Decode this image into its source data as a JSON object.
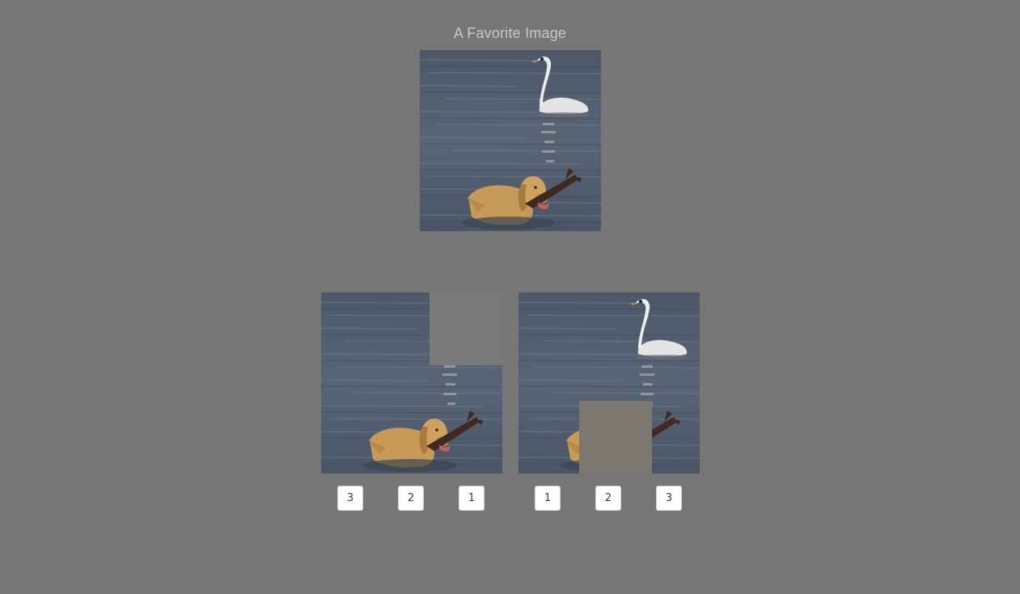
{
  "title": "A Favorite Image",
  "images": {
    "main": {
      "icon": "dog-and-swan-photo"
    },
    "left": {
      "icon": "dog-and-swan-photo-masked-top-right"
    },
    "right": {
      "icon": "dog-and-swan-photo-masked-bottom-center"
    }
  },
  "left_buttons": [
    "3",
    "2",
    "1"
  ],
  "right_buttons": [
    "1",
    "2",
    "3"
  ],
  "colors": {
    "background": "#767676",
    "title": "#c9c9c9",
    "water": "#53606f",
    "dog": "#c49a55",
    "swan": "#e6e6e6",
    "mask_left": "#7a7a7a",
    "mask_right": "#7c776f",
    "button": "#ffffff"
  }
}
